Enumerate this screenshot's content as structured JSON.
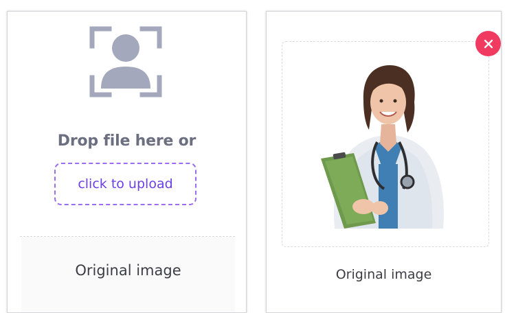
{
  "upload_card": {
    "icon": "face-scan-icon",
    "drop_text": "Drop file here or",
    "upload_button_label": "click to upload",
    "footer_label": "Original image"
  },
  "preview_card": {
    "image": "doctor-portrait",
    "close_icon": "close-icon",
    "footer_label": "Original image"
  },
  "colors": {
    "accent_purple": "#6b3fe8",
    "dashed_border": "#9c6cf0",
    "close_red": "#f03a5f",
    "icon_gray": "#a3a8bd"
  }
}
